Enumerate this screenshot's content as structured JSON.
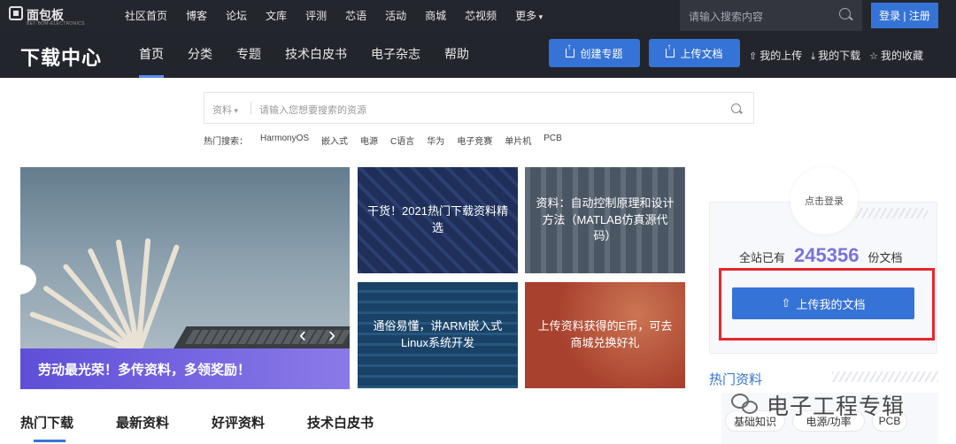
{
  "topbar": {
    "logo_name": "面包板",
    "logo_sub": "BET·BOM·ELECTRONICS",
    "nav": [
      "社区首页",
      "博客",
      "论坛",
      "文库",
      "评测",
      "芯语",
      "活动",
      "商城",
      "芯视频",
      "更多"
    ],
    "search_placeholder": "请输入搜索内容",
    "login_label": "登录 | 注册"
  },
  "secbar": {
    "title": "下载中心",
    "tabs": [
      "首页",
      "分类",
      "专题",
      "技术白皮书",
      "电子杂志",
      "帮助"
    ],
    "create_topic": "创建专题",
    "upload_doc": "上传文档",
    "my_upload": "我的上传",
    "my_download": "我的下载",
    "my_favorites": "我的收藏"
  },
  "search": {
    "category": "资料",
    "placeholder": "请输入您想要搜索的资源",
    "hot_label": "热门搜索：",
    "hot_keywords": [
      "HarmonyOS",
      "嵌入式",
      "电源",
      "C语言",
      "华为",
      "电子竞赛",
      "单片机",
      "PCB"
    ]
  },
  "hero": {
    "caption": "劳动最光荣！多传资料，多领奖励！"
  },
  "cards": [
    "干货！2021热门下载资料精选",
    "资料：自动控制原理和设计方法（MATLAB仿真源代码）",
    "通俗易懂，讲ARM嵌入式Linux系统开发",
    "上传资料获得的E币，可去商城兑换好礼"
  ],
  "content_tabs": [
    "热门下载",
    "最新资料",
    "好评资料",
    "技术白皮书"
  ],
  "sidebar": {
    "login_prompt": "点击登录",
    "stat_prefix": "全站已有",
    "doc_count": "245356",
    "stat_suffix": "份文档",
    "upload_mine": "上传我的文档",
    "hot_title": "热门资料",
    "tags": [
      "基础知识",
      "电源/功率",
      "PCB"
    ]
  },
  "watermark": "电子工程专辑"
}
